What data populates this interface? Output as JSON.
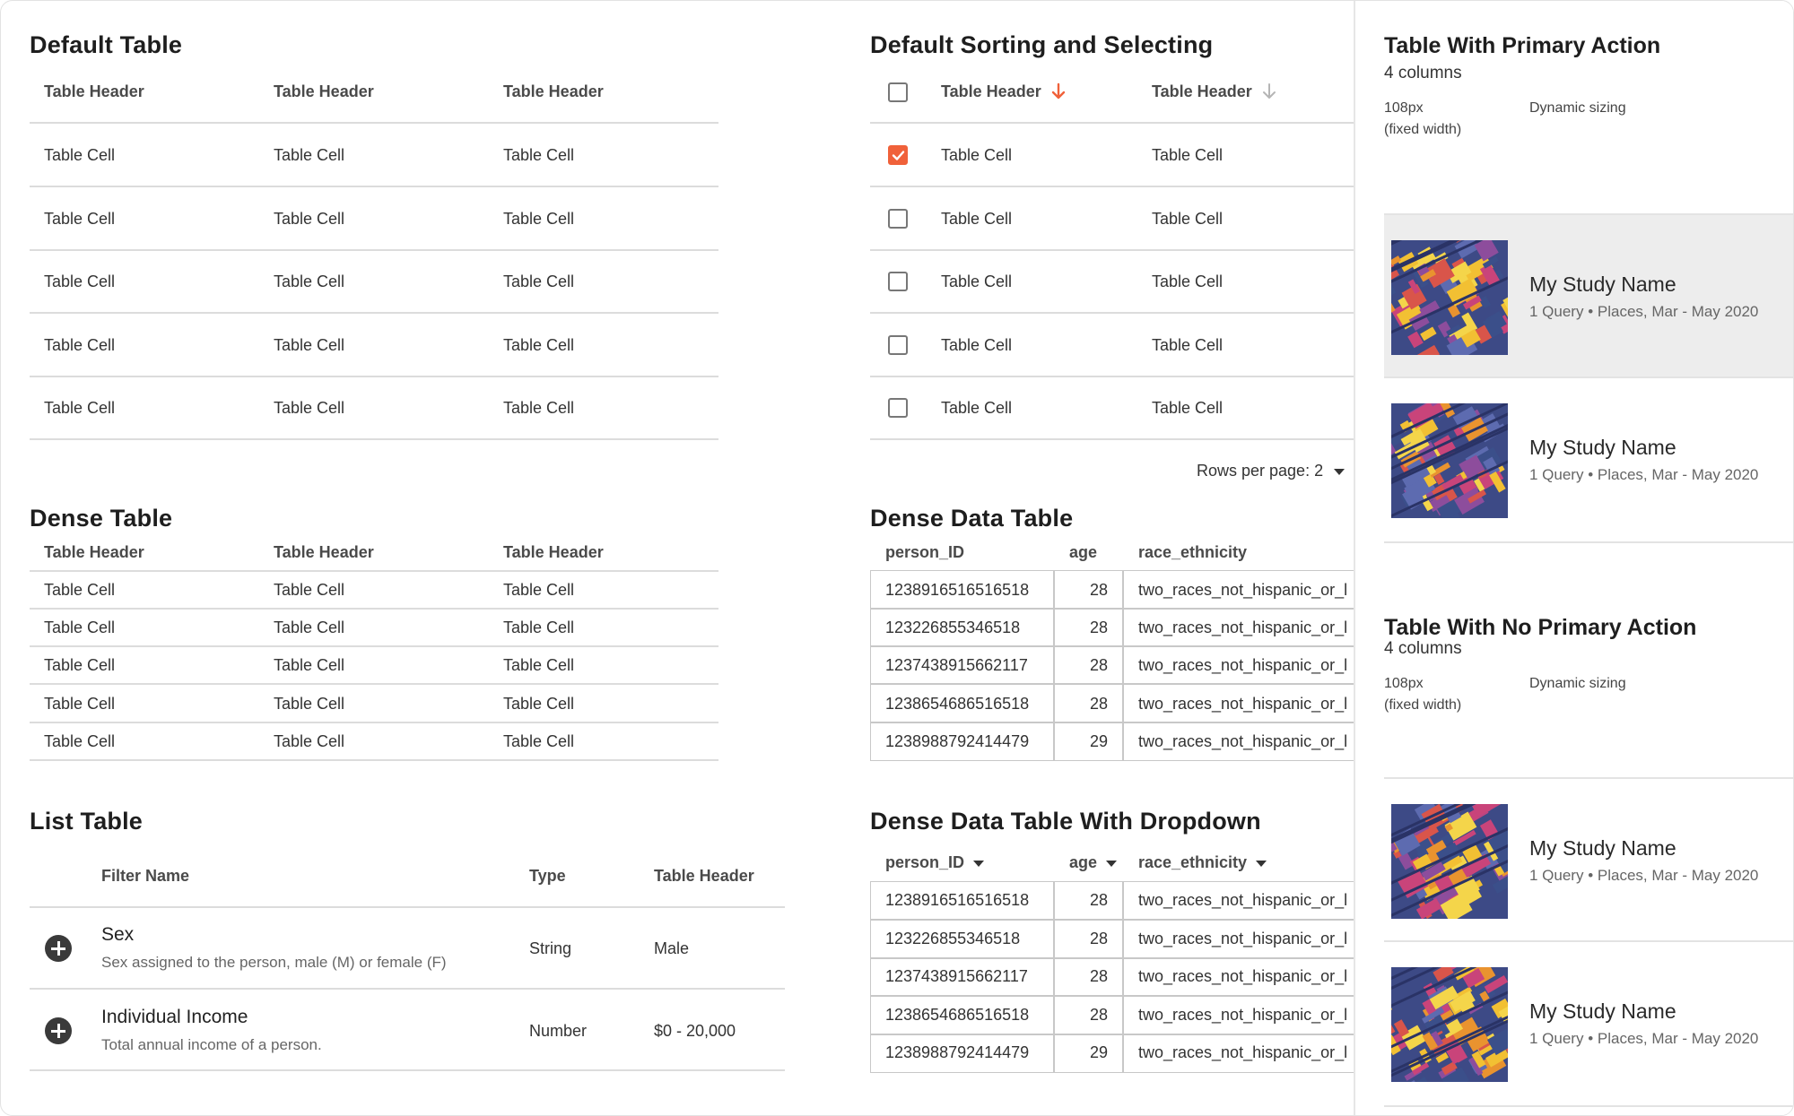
{
  "default_table": {
    "title": "Default Table",
    "headers": [
      "Table Header",
      "Table Header",
      "Table Header"
    ],
    "rows": [
      [
        "Table Cell",
        "Table Cell",
        "Table Cell"
      ],
      [
        "Table Cell",
        "Table Cell",
        "Table Cell"
      ],
      [
        "Table Cell",
        "Table Cell",
        "Table Cell"
      ],
      [
        "Table Cell",
        "Table Cell",
        "Table Cell"
      ],
      [
        "Table Cell",
        "Table Cell",
        "Table Cell"
      ]
    ]
  },
  "dense_table": {
    "title": "Dense Table",
    "headers": [
      "Table Header",
      "Table Header",
      "Table Header"
    ],
    "rows": [
      [
        "Table Cell",
        "Table Cell",
        "Table Cell"
      ],
      [
        "Table Cell",
        "Table Cell",
        "Table Cell"
      ],
      [
        "Table Cell",
        "Table Cell",
        "Table Cell"
      ],
      [
        "Table Cell",
        "Table Cell",
        "Table Cell"
      ],
      [
        "Table Cell",
        "Table Cell",
        "Table Cell"
      ]
    ]
  },
  "list_table": {
    "title": "List Table",
    "headers": [
      "Filter Name",
      "Type",
      "Table Header"
    ],
    "rows": [
      {
        "name": "Sex",
        "description": "Sex assigned to the person, male (M) or female (F)",
        "type": "String",
        "value": "Male"
      },
      {
        "name": "Individual Income",
        "description": "Total annual income of a person.",
        "type": "Number",
        "value": "$0 - 20,000"
      }
    ]
  },
  "sorting_table": {
    "title": "Default Sorting and Selecting",
    "headers": [
      "Table Header",
      "Table Header"
    ],
    "accent_color": "#f0613a",
    "rows": [
      {
        "checked": true,
        "cells": [
          "Table Cell",
          "Table Cell"
        ]
      },
      {
        "checked": false,
        "cells": [
          "Table Cell",
          "Table Cell"
        ]
      },
      {
        "checked": false,
        "cells": [
          "Table Cell",
          "Table Cell"
        ]
      },
      {
        "checked": false,
        "cells": [
          "Table Cell",
          "Table Cell"
        ]
      },
      {
        "checked": false,
        "cells": [
          "Table Cell",
          "Table Cell"
        ]
      }
    ],
    "rows_per_page_label": "Rows per page: 2"
  },
  "dense_data_table": {
    "title": "Dense Data Table",
    "headers": [
      "person_ID",
      "age",
      "race_ethnicity"
    ],
    "rows": [
      [
        "1238916516516518",
        "28",
        "two_races_not_hispanic_or_l"
      ],
      [
        "123226855346518",
        "28",
        "two_races_not_hispanic_or_l"
      ],
      [
        "1237438915662117",
        "28",
        "two_races_not_hispanic_or_l"
      ],
      [
        "1238654686516518",
        "28",
        "two_races_not_hispanic_or_l"
      ],
      [
        "1238988792414479",
        "29",
        "two_races_not_hispanic_or_l"
      ]
    ]
  },
  "dense_data_dropdown": {
    "title": "Dense Data Table With Dropdown",
    "headers": [
      "person_ID",
      "age",
      "race_ethnicity"
    ],
    "rows": [
      [
        "1238916516516518",
        "28",
        "two_races_not_hispanic_or_l"
      ],
      [
        "123226855346518",
        "28",
        "two_races_not_hispanic_or_l"
      ],
      [
        "1237438915662117",
        "28",
        "two_races_not_hispanic_or_l"
      ],
      [
        "1238654686516518",
        "28",
        "two_races_not_hispanic_or_l"
      ],
      [
        "1238988792414479",
        "29",
        "two_races_not_hispanic_or_l"
      ]
    ]
  },
  "primary_action": {
    "title": "Table With Primary Action",
    "subtitle": "4 columns",
    "col1_label": "108px",
    "col1_note": "(fixed width)",
    "col2_label": "Dynamic sizing",
    "items": [
      {
        "name": "My Study Name",
        "meta": "1 Query • Places, Mar - May 2020",
        "selected": true
      },
      {
        "name": "My Study Name",
        "meta": "1 Query • Places, Mar - May 2020",
        "selected": false
      }
    ]
  },
  "no_primary_action": {
    "title": "Table With No Primary Action",
    "subtitle": "4 columns",
    "col1_label": "108px",
    "col1_note": "(fixed width)",
    "col2_label": "Dynamic sizing",
    "items": [
      {
        "name": "My Study Name",
        "meta": "1 Query • Places, Mar - May 2020"
      },
      {
        "name": "My Study Name",
        "meta": "1 Query • Places, Mar - May 2020"
      }
    ]
  },
  "colors": {
    "accent": "#f0613a",
    "divider": "#dcdcdc",
    "selected_row": "#ededed"
  }
}
